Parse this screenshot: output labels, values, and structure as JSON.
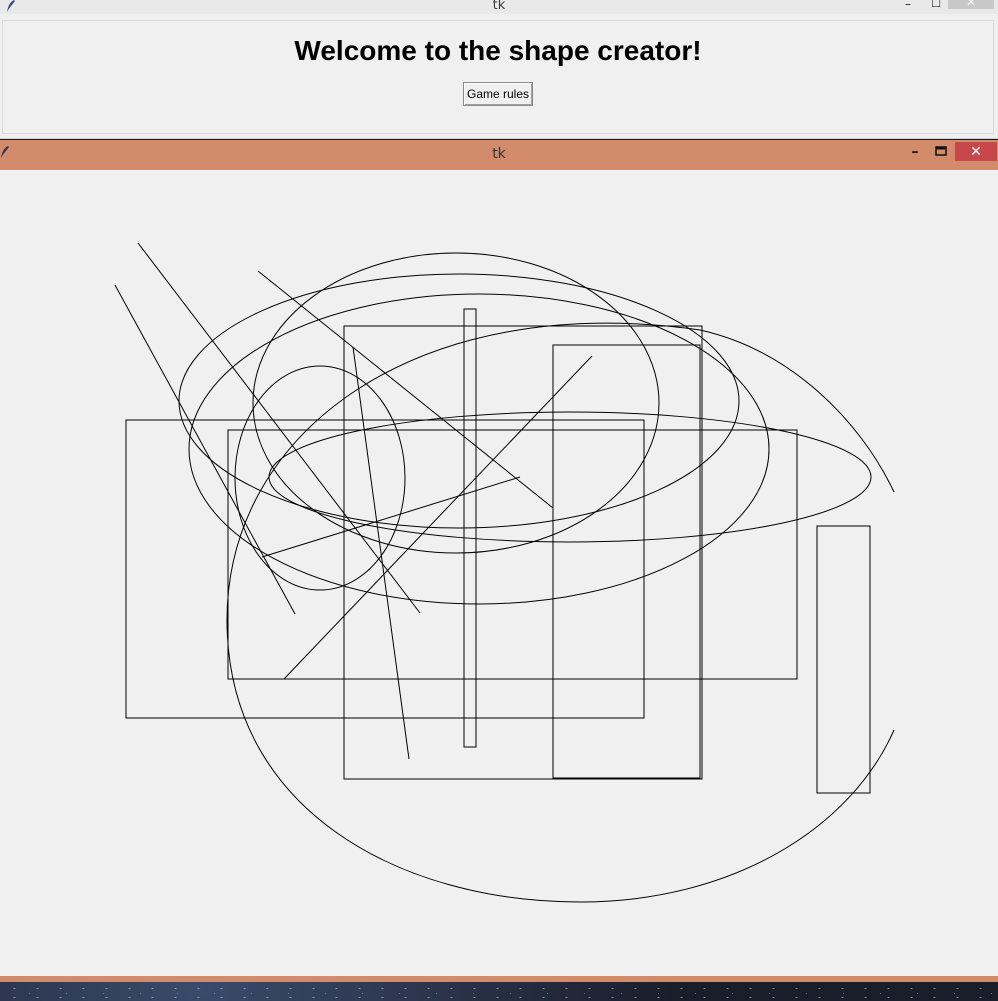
{
  "window1": {
    "title": "tk",
    "heading": "Welcome to the shape creator!",
    "rules_button": "Game rules",
    "controls": {
      "minimize": "–",
      "maximize": "☐",
      "close": "✕"
    }
  },
  "window2": {
    "title": "tk",
    "controls": {
      "minimize": "–",
      "maximize": "🗖",
      "close": "✕"
    },
    "accent_color": "#d28b6b",
    "close_color": "#c7474b"
  },
  "canvas": {
    "background": "#f0f0f0",
    "stroke": "#000000",
    "shapes": [
      {
        "kind": "rect"
      },
      {
        "kind": "rect"
      },
      {
        "kind": "rect"
      },
      {
        "kind": "rect"
      },
      {
        "kind": "rect"
      },
      {
        "kind": "rect"
      },
      {
        "kind": "ellipse"
      },
      {
        "kind": "ellipse"
      },
      {
        "kind": "ellipse"
      },
      {
        "kind": "ellipse"
      },
      {
        "kind": "ellipse"
      },
      {
        "kind": "ellipse"
      },
      {
        "kind": "line"
      },
      {
        "kind": "line"
      },
      {
        "kind": "line"
      },
      {
        "kind": "line"
      },
      {
        "kind": "line"
      },
      {
        "kind": "line"
      }
    ]
  }
}
